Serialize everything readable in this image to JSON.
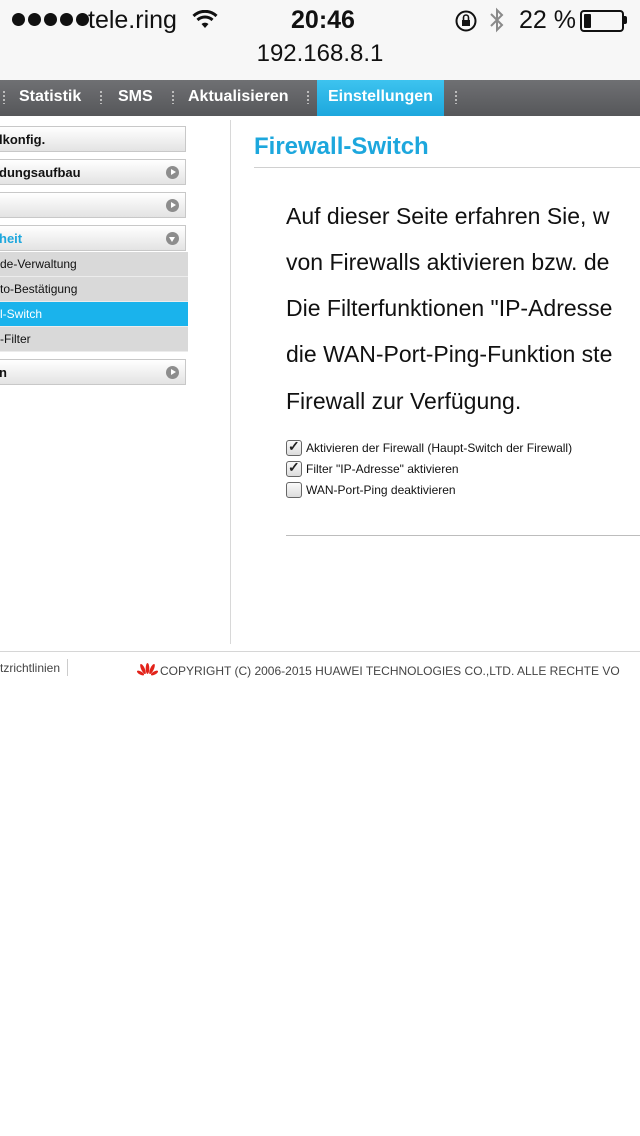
{
  "status_bar": {
    "carrier": "tele.ring",
    "time": "20:46",
    "battery_percent": "22 %",
    "battery_level": 0.22,
    "signal_dots": 5,
    "icons": [
      "wifi-icon",
      "orientation-lock-icon",
      "bluetooth-icon",
      "battery-icon"
    ]
  },
  "browser": {
    "url": "192.168.8.1"
  },
  "nav": {
    "items": [
      {
        "label": "Statistik"
      },
      {
        "label": "SMS"
      },
      {
        "label": "Aktualisieren"
      },
      {
        "label": "Einstellungen",
        "active": true
      }
    ]
  },
  "sidebar": {
    "items": [
      {
        "label": "lkonfig."
      },
      {
        "label": "dungsaufbau"
      },
      {
        "label": ""
      },
      {
        "label": "heit",
        "expanded": true
      },
      {
        "label": "n"
      }
    ],
    "subitems": [
      {
        "label": "de-Verwaltung"
      },
      {
        "label": "to-Bestätigung"
      },
      {
        "label": "l-Switch",
        "active": true
      },
      {
        "label": "-Filter"
      }
    ]
  },
  "main": {
    "title": "Firewall-Switch",
    "description_lines": [
      "Auf dieser Seite erfahren Sie, w",
      "von Firewalls aktivieren bzw. de",
      "Die Filterfunktionen \"IP-Adresse",
      "die WAN-Port-Ping-Funktion ste",
      "Firewall zur Verfügung."
    ],
    "options": [
      {
        "label": "Aktivieren der Firewall (Haupt-Switch der Firewall)",
        "checked": true
      },
      {
        "label": "Filter \"IP-Adresse\" aktivieren",
        "checked": true
      },
      {
        "label": "WAN-Port-Ping deaktivieren",
        "checked": false
      }
    ]
  },
  "footer": {
    "link": "tzrichtlinien",
    "copyright": "COPYRIGHT (C) 2006-2015 HUAWEI TECHNOLOGIES CO.,LTD. ALLE RECHTE VO"
  },
  "colors": {
    "accent": "#1da7dd",
    "nav_bg": "#606164"
  }
}
